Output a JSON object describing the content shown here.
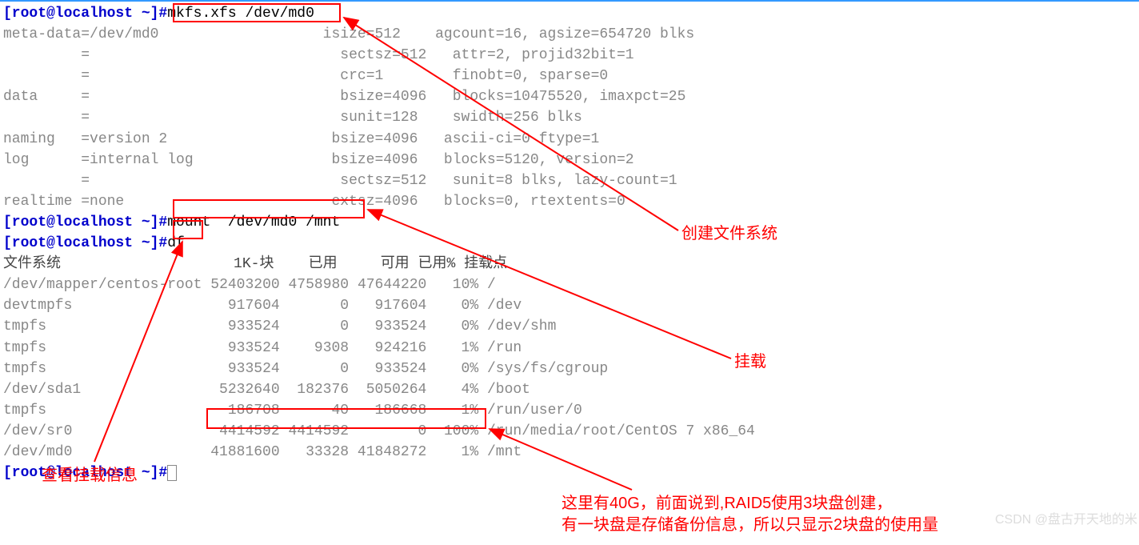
{
  "prompt_text": "[root@localhost ~]#",
  "commands": {
    "mkfs": "mkfs.xfs /dev/md0",
    "mount": "mount  /dev/md0 /mnt",
    "df": "df"
  },
  "mkfs_output": {
    "line1_left": "meta-data=/dev/md0",
    "line1_mid": "isize=512",
    "line1_right": "agcount=16, agsize=654720 blks",
    "line2_left": "         =",
    "line2_mid": "sectsz=512",
    "line2_right": "attr=2, projid32bit=1",
    "line3_left": "         =",
    "line3_mid": "crc=1",
    "line3_right": "finobt=0, sparse=0",
    "line4_left": "data     =",
    "line4_mid": "bsize=4096",
    "line4_right": "blocks=10475520, imaxpct=25",
    "line5_left": "         =",
    "line5_mid": "sunit=128",
    "line5_right": "swidth=256 blks",
    "line6_left": "naming   =version 2",
    "line6_mid": "bsize=4096",
    "line6_right": "ascii-ci=0 ftype=1",
    "line7_left": "log      =internal log",
    "line7_mid": "bsize=4096",
    "line7_right": "blocks=5120, version=2",
    "line8_left": "         =",
    "line8_mid": "sectsz=512",
    "line8_right": "sunit=8 blks, lazy-count=1",
    "line9_left": "realtime =none",
    "line9_mid": "extsz=4096",
    "line9_right": "blocks=0, rtextents=0"
  },
  "df_header": {
    "fs": "文件系统",
    "blocks": "1K-块",
    "used": "已用",
    "avail": "可用",
    "usepct": "已用%",
    "mount": "挂载点"
  },
  "df_rows": [
    {
      "fs": "/dev/mapper/centos-root",
      "blocks": "52403200",
      "used": "4758980",
      "avail": "47644220",
      "pct": "10%",
      "mnt": "/"
    },
    {
      "fs": "devtmpfs",
      "blocks": "917604",
      "used": "0",
      "avail": "917604",
      "pct": "0%",
      "mnt": "/dev"
    },
    {
      "fs": "tmpfs",
      "blocks": "933524",
      "used": "0",
      "avail": "933524",
      "pct": "0%",
      "mnt": "/dev/shm"
    },
    {
      "fs": "tmpfs",
      "blocks": "933524",
      "used": "9308",
      "avail": "924216",
      "pct": "1%",
      "mnt": "/run"
    },
    {
      "fs": "tmpfs",
      "blocks": "933524",
      "used": "0",
      "avail": "933524",
      "pct": "0%",
      "mnt": "/sys/fs/cgroup"
    },
    {
      "fs": "/dev/sda1",
      "blocks": "5232640",
      "used": "182376",
      "avail": "5050264",
      "pct": "4%",
      "mnt": "/boot"
    },
    {
      "fs": "tmpfs",
      "blocks": "186708",
      "used": "40",
      "avail": "186668",
      "pct": "1%",
      "mnt": "/run/user/0"
    },
    {
      "fs": "/dev/sr0",
      "blocks": "4414592",
      "used": "4414592",
      "avail": "0",
      "pct": "100%",
      "mnt": "/run/media/root/CentOS 7 x86_64"
    },
    {
      "fs": "/dev/md0",
      "blocks": "41881600",
      "used": "33328",
      "avail": "41848272",
      "pct": "1%",
      "mnt": "/mnt"
    }
  ],
  "annotations": {
    "create_fs": "创建文件系统",
    "mount": "挂载",
    "view_mount": "查看挂载信息",
    "raid_note_1": "这里有40G，前面说到,RAID5使用3块盘创建，",
    "raid_note_2": "有一块盘是存储备份信息，所以只显示2块盘的使用量"
  },
  "watermark": "CSDN @盘古开天地的米"
}
